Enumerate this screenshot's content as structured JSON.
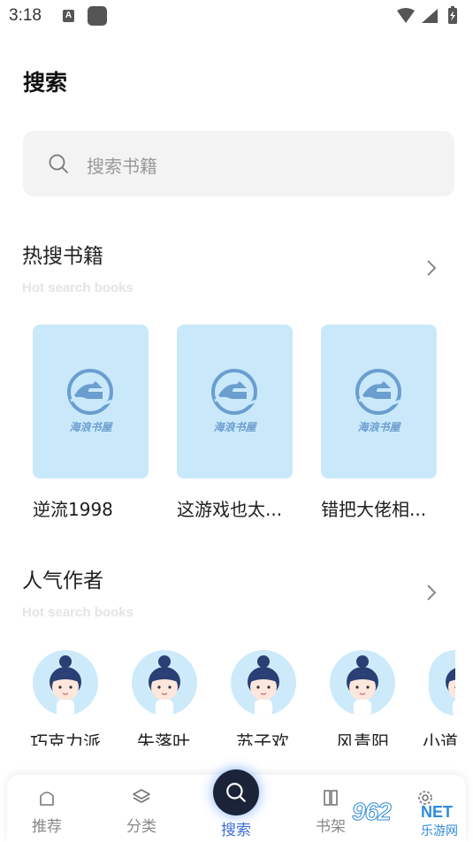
{
  "status_bar": {
    "time": "3:18",
    "a_badge": "A"
  },
  "page": {
    "title": "搜索"
  },
  "search": {
    "placeholder": "搜索书籍"
  },
  "hot_books": {
    "title": "热搜书籍",
    "subtitle": "Hot search books",
    "logo_text": "海浪书屋",
    "items": [
      {
        "title": "逆流1998"
      },
      {
        "title": "这游戏也太..."
      },
      {
        "title": "错把大佬相..."
      }
    ]
  },
  "popular_authors": {
    "title": "人气作者",
    "subtitle": "Hot search books",
    "items": [
      {
        "name": "巧克力派"
      },
      {
        "name": "失落叶"
      },
      {
        "name": "苏子欢"
      },
      {
        "name": "风青阳"
      },
      {
        "name": "小道"
      }
    ]
  },
  "bottom_nav": {
    "items": [
      {
        "label": "推荐",
        "icon": "home-icon"
      },
      {
        "label": "分类",
        "icon": "layers-icon"
      },
      {
        "label": "搜索",
        "icon": "search-icon"
      },
      {
        "label": "书架",
        "icon": "bookshelf-icon"
      },
      {
        "label": "",
        "icon": "gear-icon"
      }
    ]
  },
  "watermark": {
    "number": "962",
    "net": "NET",
    "sub": "乐游网"
  },
  "colors": {
    "accent": "#3d6fd8",
    "card_bg": "#c9e9fb",
    "logo": "#6c9dcf"
  }
}
